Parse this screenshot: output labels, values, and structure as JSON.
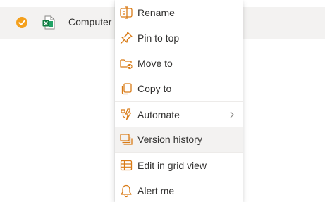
{
  "file_row": {
    "name": "Computer",
    "selected": true,
    "file_type_icon": "excel-icon"
  },
  "colors": {
    "accent": "#d97b16",
    "check": "#f4a01c",
    "excel": "#107c41",
    "hover": "#f3f2f1"
  },
  "menu": {
    "items": [
      {
        "label": "Rename",
        "icon": "rename-icon"
      },
      {
        "label": "Pin to top",
        "icon": "pin-icon"
      },
      {
        "label": "Move to",
        "icon": "move-folder-icon"
      },
      {
        "label": "Copy to",
        "icon": "copy-icon"
      },
      {
        "label": "Automate",
        "icon": "automate-icon",
        "submenu": true
      },
      {
        "label": "Version history",
        "icon": "version-history-icon",
        "highlighted": true
      },
      {
        "label": "Edit in grid view",
        "icon": "grid-icon"
      },
      {
        "label": "Alert me",
        "icon": "bell-icon"
      }
    ]
  }
}
